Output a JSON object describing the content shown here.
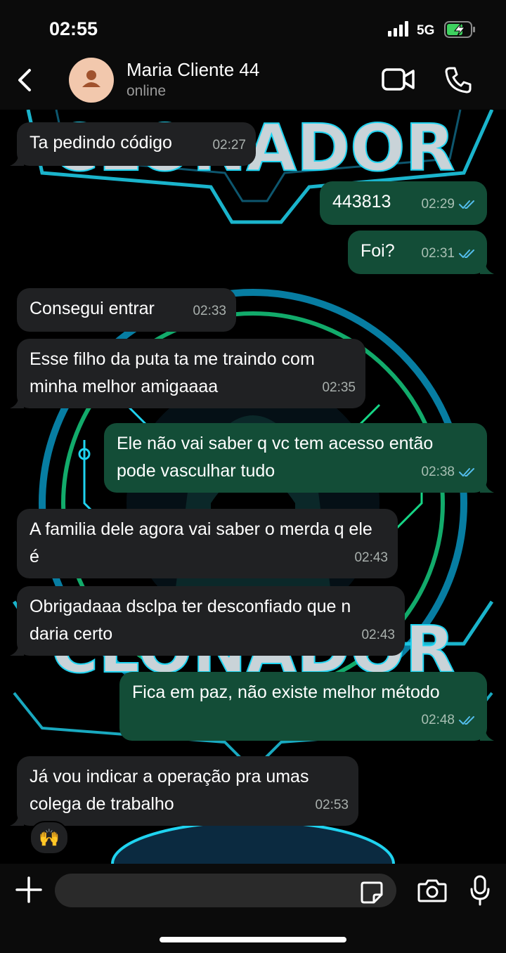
{
  "status_bar": {
    "time": "02:55",
    "network": "5G"
  },
  "header": {
    "contact_name": "Maria Cliente 44",
    "contact_status": "online"
  },
  "background": {
    "brand_word": "CLONADOR"
  },
  "messages": [
    {
      "dir": "in",
      "text": "Ta pedindo código",
      "time": "02:27"
    },
    {
      "dir": "out",
      "text": "443813",
      "time": "02:29"
    },
    {
      "dir": "out",
      "text": "Foi?",
      "time": "02:31"
    },
    {
      "dir": "in",
      "text": "Consegui entrar",
      "time": "02:33"
    },
    {
      "dir": "in",
      "text": "Esse filho da puta ta me traindo com minha melhor amigaaaa",
      "time": "02:35"
    },
    {
      "dir": "out",
      "text": "Ele não vai saber q vc tem acesso então pode vasculhar tudo",
      "time": "02:38"
    },
    {
      "dir": "in",
      "text": "A familia dele agora vai saber o merda q ele é",
      "time": "02:43"
    },
    {
      "dir": "in",
      "text": "Obrigadaaa dsclpa ter desconfiado que n daria certo",
      "time": "02:43"
    },
    {
      "dir": "out",
      "text": "Fica em paz, não existe melhor método",
      "time": "02:48"
    },
    {
      "dir": "in",
      "text": "Já vou indicar a operação pra umas colega de trabalho",
      "time": "02:53"
    }
  ],
  "reaction": {
    "emoji": "🙌"
  },
  "composer": {
    "placeholder": ""
  },
  "colors": {
    "incoming": "#202123",
    "outgoing": "#134d37",
    "read_ticks": "#53bdeb"
  }
}
